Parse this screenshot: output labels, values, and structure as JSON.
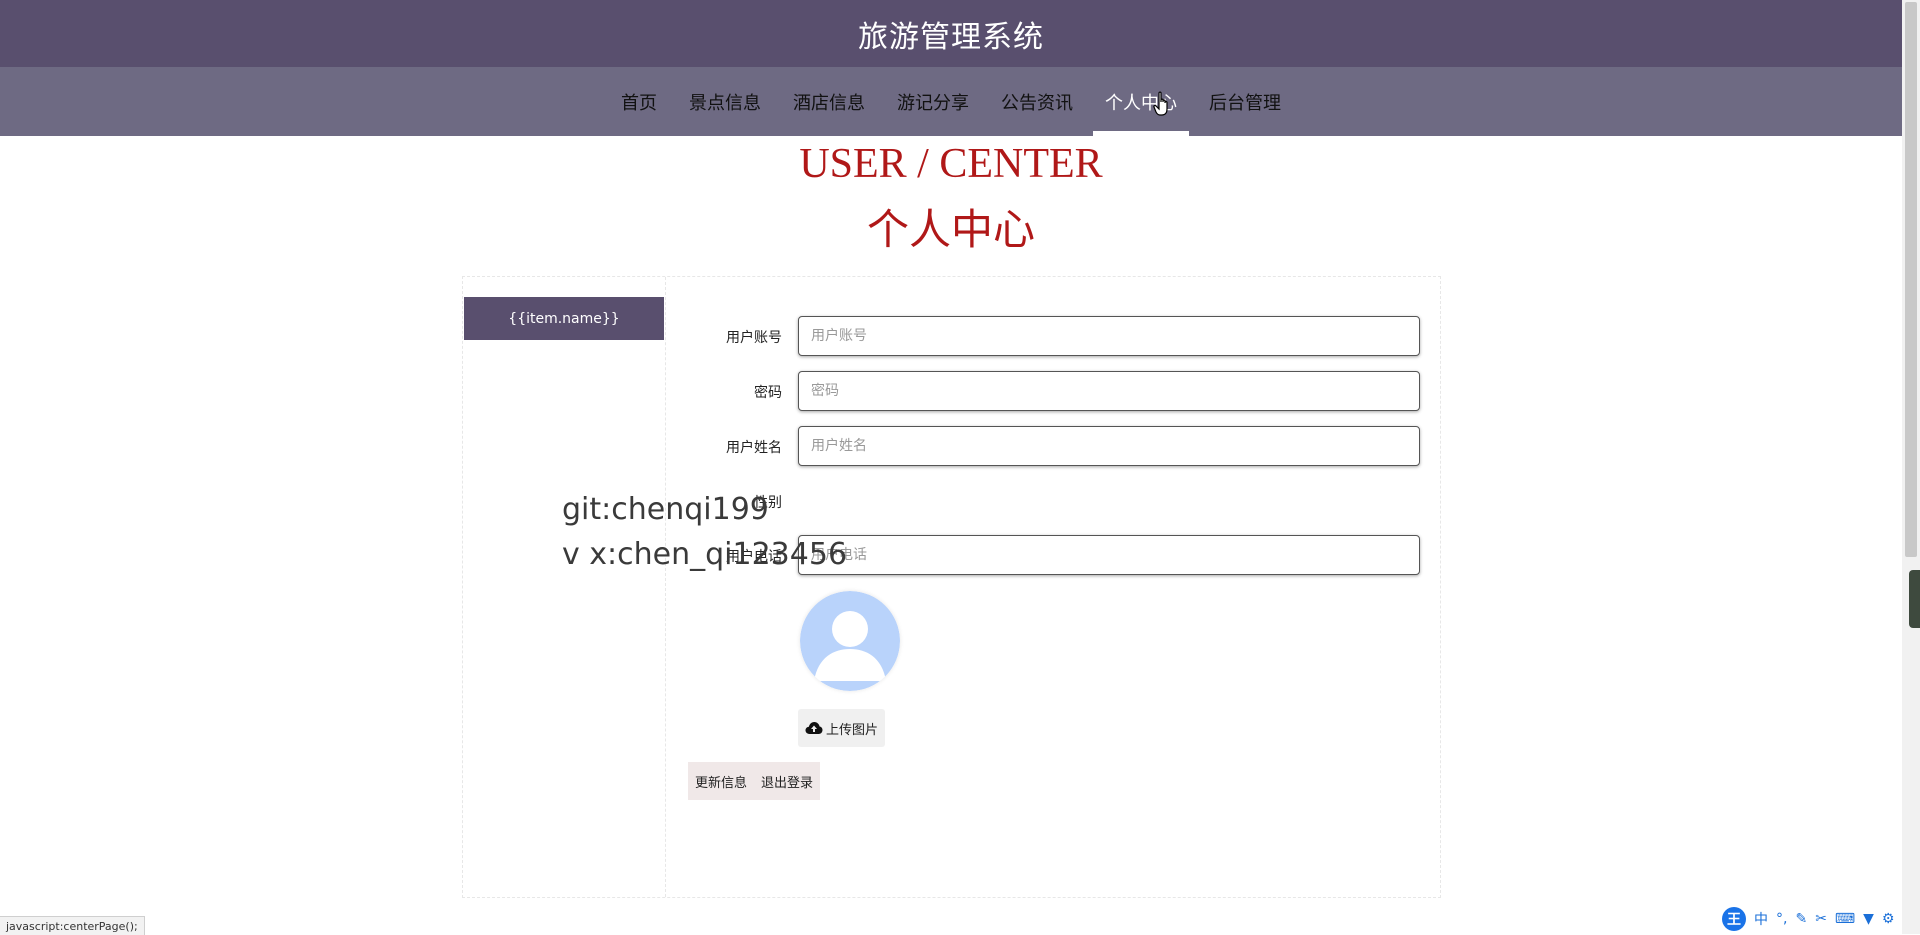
{
  "header": {
    "title": "旅游管理系统"
  },
  "nav": {
    "items": [
      {
        "label": "首页",
        "active": false
      },
      {
        "label": "景点信息",
        "active": false
      },
      {
        "label": "酒店信息",
        "active": false
      },
      {
        "label": "游记分享",
        "active": false
      },
      {
        "label": "公告资讯",
        "active": false
      },
      {
        "label": "个人中心",
        "active": true
      },
      {
        "label": "后台管理",
        "active": false
      }
    ]
  },
  "page": {
    "title_en": "USER / CENTER",
    "title_cn": "个人中心"
  },
  "sidebar": {
    "item_label": "{{item.name}}"
  },
  "form": {
    "account": {
      "label": "用户账号",
      "placeholder": "用户账号",
      "value": ""
    },
    "password": {
      "label": "密码",
      "placeholder": "密码",
      "value": ""
    },
    "name": {
      "label": "用户姓名",
      "placeholder": "用户姓名",
      "value": ""
    },
    "gender": {
      "label": "性别"
    },
    "phone": {
      "label": "用户电话",
      "placeholder": "用户电话",
      "value": ""
    },
    "upload_label": "上传图片",
    "update_label": "更新信息",
    "logout_label": "退出登录"
  },
  "watermark": {
    "line1": "git:chenqi199",
    "line2": "v x:chen_qi123456"
  },
  "status_bar": {
    "text": "javascript:centerPage();"
  },
  "ime": {
    "logo": "王",
    "mode": "中",
    "punct": "°,"
  },
  "colors": {
    "header": "#594f6e",
    "nav": "#6e6a83",
    "accent": "#b01818",
    "sidebar_item": "#594f6e"
  }
}
